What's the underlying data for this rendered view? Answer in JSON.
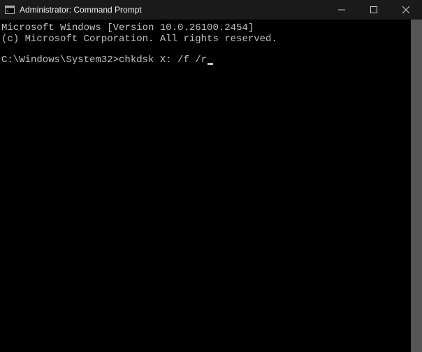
{
  "titlebar": {
    "title": "Administrator: Command Prompt"
  },
  "terminal": {
    "line1": "Microsoft Windows [Version 10.0.26100.2454]",
    "line2": "(c) Microsoft Corporation. All rights reserved.",
    "prompt": "C:\\Windows\\System32>",
    "command": "chkdsk X: /f /r"
  }
}
